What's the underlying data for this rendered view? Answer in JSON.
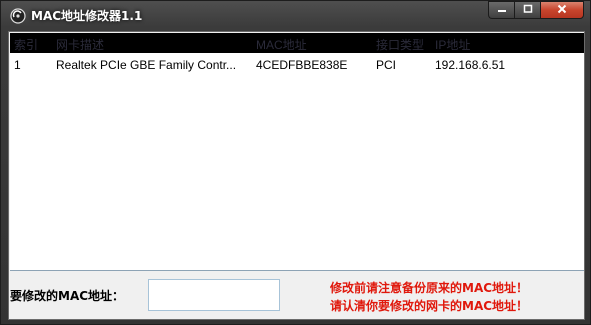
{
  "window": {
    "title": "MAC地址修改器1.1",
    "app_icon": "app-disc-icon"
  },
  "caption": {
    "minimize_glyph": "▁",
    "maximize_glyph": "□",
    "close_glyph": "✕"
  },
  "table": {
    "columns": [
      "索引",
      "网卡描述",
      "MAC地址",
      "接口类型",
      "IP地址"
    ],
    "rows": [
      [
        "1",
        "Realtek PCIe GBE Family Contr...",
        "4CEDFBBE838E",
        "PCI",
        "192.168.6.51"
      ]
    ]
  },
  "form": {
    "mac_label": "要修改的MAC地址：",
    "mac_value": "",
    "mac_placeholder": ""
  },
  "warnings": [
    "修改前请注意备份原来的MAC地址！",
    "请认清你要修改的网卡的MAC地址！"
  ],
  "colors": {
    "warning": "#e0180c",
    "header_bg": "#000000",
    "close_button": "#c8452d"
  }
}
